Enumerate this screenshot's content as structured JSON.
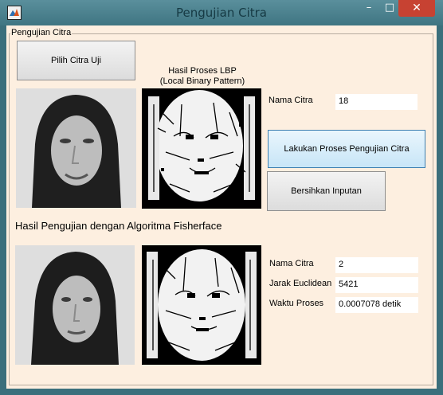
{
  "window": {
    "title": "Pengujian Citra",
    "minimize_glyph": "–",
    "maximize_glyph": "□",
    "close_glyph": "✕",
    "app_icon": "matlab-figure-icon"
  },
  "panel": {
    "title": "Pengujian Citra"
  },
  "buttons": {
    "pilih": "Pilih Citra Uji",
    "proses": "Lakukan Proses Pengujian Citra",
    "bersihkan": "Bersihkan Inputan"
  },
  "lbp_title": {
    "line1": "Hasil Proses LBP",
    "line2": "(Local Binary Pattern)"
  },
  "input": {
    "nama_label": "Nama Citra",
    "nama_value": "18"
  },
  "result_heading": "Hasil Pengujian dengan Algoritma Fisherface",
  "result": {
    "nama_label": "Nama Citra",
    "nama_value": "2",
    "jarak_label": "Jarak Euclidean",
    "jarak_value": "5421",
    "waktu_label": "Waktu Proses",
    "waktu_value": "0.0007078 detik"
  },
  "images": {
    "test_face": "grayscale-face-photo",
    "test_lbp": "lbp-binary-pattern-image",
    "result_face": "grayscale-face-photo",
    "result_lbp": "lbp-binary-pattern-image"
  },
  "colors": {
    "background": "#fdefe0",
    "titlebar": "#4a7f8c",
    "close": "#c74232",
    "accent_button": "#c7e5f7"
  }
}
